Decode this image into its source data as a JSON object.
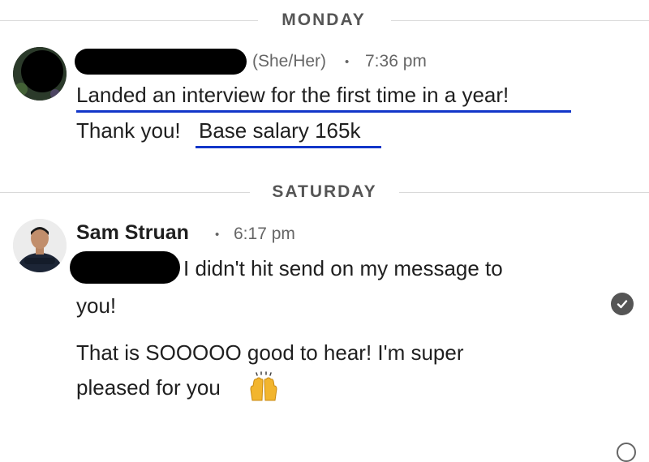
{
  "conversation": {
    "dividers": [
      {
        "label": "MONDAY"
      },
      {
        "label": "SATURDAY"
      }
    ],
    "message1": {
      "pronouns": "(She/Her)",
      "separator": "•",
      "time": "7:36 pm",
      "line1": "Landed an interview for the first time in a year!",
      "line2a": "Thank you!",
      "line2b": "Base salary 165k",
      "underline_color": "#1236c9"
    },
    "message2": {
      "sender": "Sam Struan",
      "separator": "•",
      "time": "6:17 pm",
      "line1": "I didn't hit send on my message to",
      "line2": "you!",
      "line3": "That is SOOOOO good to hear! I'm super",
      "line4": "pleased for you",
      "emoji": "raising-hands-emoji",
      "status_icon": "read-check-icon"
    }
  }
}
